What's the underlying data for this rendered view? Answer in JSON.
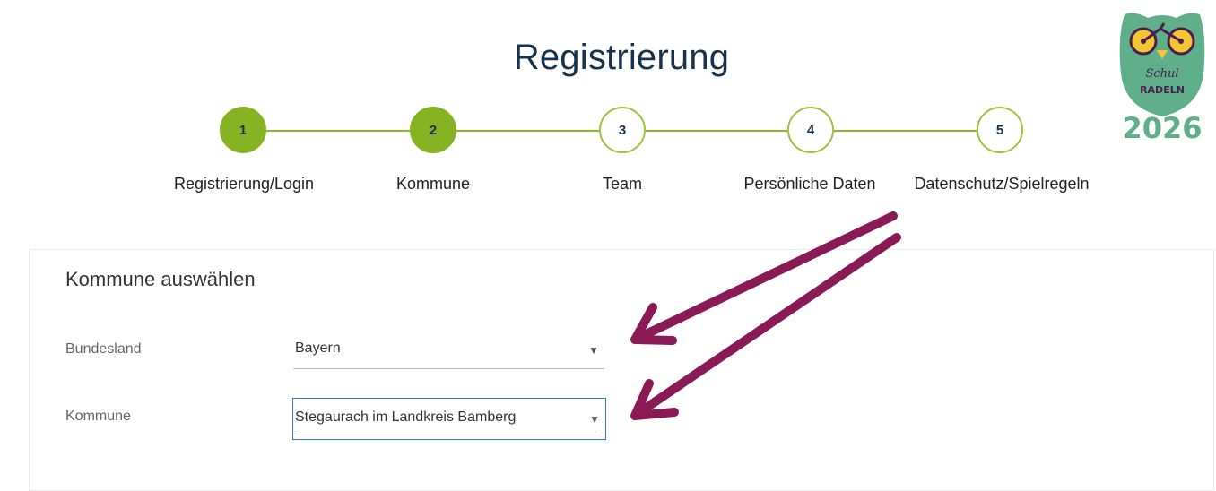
{
  "header": {
    "title": "Registrierung"
  },
  "stepper": {
    "steps": [
      {
        "number": "1",
        "label": "Registrierung/Login",
        "state": "done"
      },
      {
        "number": "2",
        "label": "Kommune",
        "state": "done"
      },
      {
        "number": "3",
        "label": "Team",
        "state": "todo"
      },
      {
        "number": "4",
        "label": "Persönliche Daten",
        "state": "todo"
      },
      {
        "number": "5",
        "label": "Datenschutz/Spielregeln",
        "state": "todo"
      }
    ],
    "colors": {
      "done": "#86b324",
      "line": "#8cb82a",
      "text": "#17324d"
    }
  },
  "logo": {
    "line1": "Schul",
    "line2": "RADELN",
    "year": "2026",
    "color": "#5fb08a"
  },
  "form": {
    "title": "Kommune auswählen",
    "bundesland": {
      "label": "Bundesland",
      "value": "Bayern"
    },
    "kommune": {
      "label": "Kommune",
      "value": "Stegaurach im Landkreis Bamberg"
    }
  },
  "annotation": {
    "arrow_color": "#8a1a55"
  }
}
